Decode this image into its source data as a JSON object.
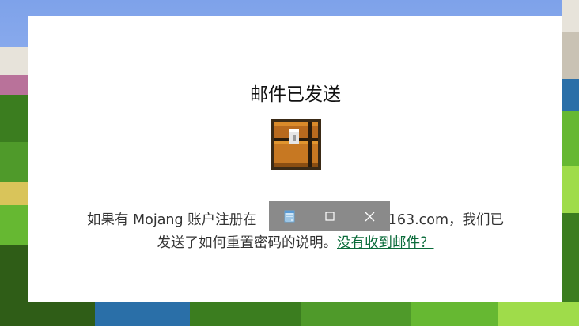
{
  "dialog": {
    "title": "邮件已发送",
    "message_line1": "如果有 Mojang 账户注册在",
    "message_hidden_tail": "163.com，我们已",
    "message_line2": "发送了如何重置密码的说明。",
    "link_label": "没有收到邮件？"
  },
  "icons": {
    "chest": "treasure-chest-icon",
    "notepad": "notepad-icon",
    "maximize": "maximize-icon",
    "close": "close-icon"
  },
  "colors": {
    "link": "#0a6b3a",
    "card": "#ffffff",
    "snapbar": "#8a8a8a"
  }
}
